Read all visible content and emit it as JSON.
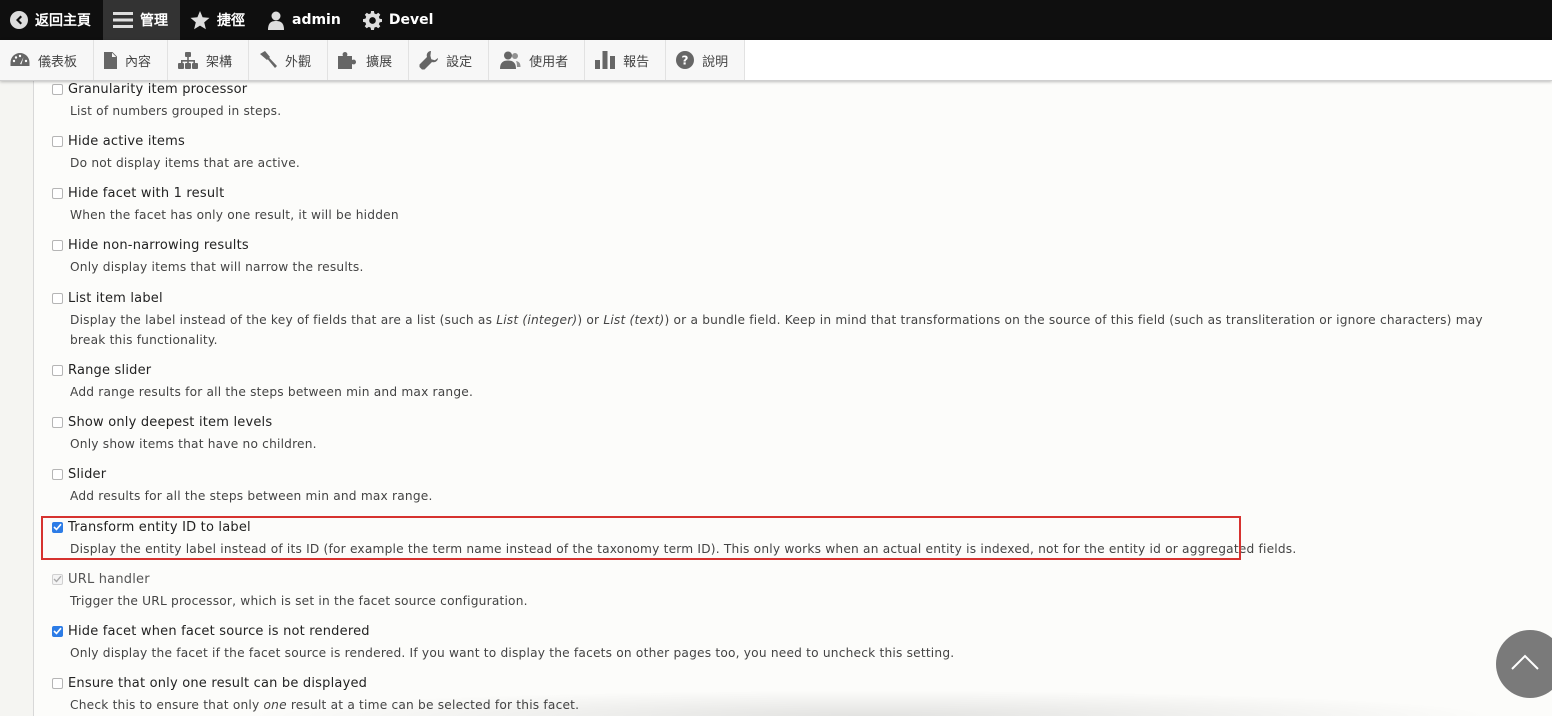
{
  "toolbar": {
    "items": [
      {
        "label": "返回主頁",
        "icon": "back-circle-icon"
      },
      {
        "label": "管理",
        "icon": "menu-icon",
        "active": true
      },
      {
        "label": "捷徑",
        "icon": "star-icon"
      },
      {
        "label": "admin",
        "icon": "user-icon"
      },
      {
        "label": "Devel",
        "icon": "gear-icon"
      }
    ]
  },
  "tray": {
    "items": [
      {
        "label": "儀表板",
        "icon": "dashboard-icon"
      },
      {
        "label": "內容",
        "icon": "file-icon"
      },
      {
        "label": "架構",
        "icon": "structure-icon"
      },
      {
        "label": "外觀",
        "icon": "paintbrush-icon"
      },
      {
        "label": "擴展",
        "icon": "puzzle-icon"
      },
      {
        "label": "設定",
        "icon": "wrench-icon"
      },
      {
        "label": "使用者",
        "icon": "people-icon"
      },
      {
        "label": "報告",
        "icon": "bar-chart-icon"
      },
      {
        "label": "說明",
        "icon": "help-icon"
      }
    ]
  },
  "options": [
    {
      "label": "Granularity item processor",
      "desc": "List of numbers grouped in steps.",
      "state": "unchecked"
    },
    {
      "label": "Hide active items",
      "desc": "Do not display items that are active.",
      "state": "unchecked"
    },
    {
      "label": "Hide facet with 1 result",
      "desc": "When the facet has only one result, it will be hidden",
      "state": "unchecked"
    },
    {
      "label": "Hide non-narrowing results",
      "desc": "Only display items that will narrow the results.",
      "state": "unchecked"
    },
    {
      "label": "List item label",
      "desc_parts": [
        "Display the label instead of the key of fields that are a list (such as ",
        "List (integer)",
        ") or ",
        "List (text)",
        ") or a bundle field. Keep in mind that transformations on the source of this field (such as transliteration or ignore characters) may break this functionality."
      ],
      "state": "unchecked"
    },
    {
      "label": "Range slider",
      "desc": "Add range results for all the steps between min and max range.",
      "state": "unchecked"
    },
    {
      "label": "Show only deepest item levels",
      "desc": "Only show items that have no children.",
      "state": "unchecked"
    },
    {
      "label": "Slider",
      "desc": "Add results for all the steps between min and max range.",
      "state": "unchecked"
    },
    {
      "label": "Transform entity ID to label",
      "desc": "Display the entity label instead of its ID (for example the term name instead of the taxonomy term ID). This only works when an actual entity is indexed, not for the entity id or aggregated fields.",
      "state": "checked",
      "highlighted": true
    },
    {
      "label": "URL handler",
      "desc": "Trigger the URL processor, which is set in the facet source configuration.",
      "state": "disabled-checked"
    },
    {
      "label": "Hide facet when facet source is not rendered",
      "desc": "Only display the facet if the facet source is rendered. If you want to display the facets on other pages too, you need to uncheck this setting.",
      "state": "checked"
    },
    {
      "label": "Ensure that only one result can be displayed",
      "desc_parts": [
        "Check this to ensure that only ",
        "one",
        " result at a time can be selected for this facet."
      ],
      "state": "unchecked"
    }
  ],
  "colors": {
    "toolbar_bg": "#0f0f0f",
    "checkbox_checked": "#2d7ce6",
    "highlight_border": "#d6322f"
  },
  "scroll_top_icon": "chevron-up-icon"
}
